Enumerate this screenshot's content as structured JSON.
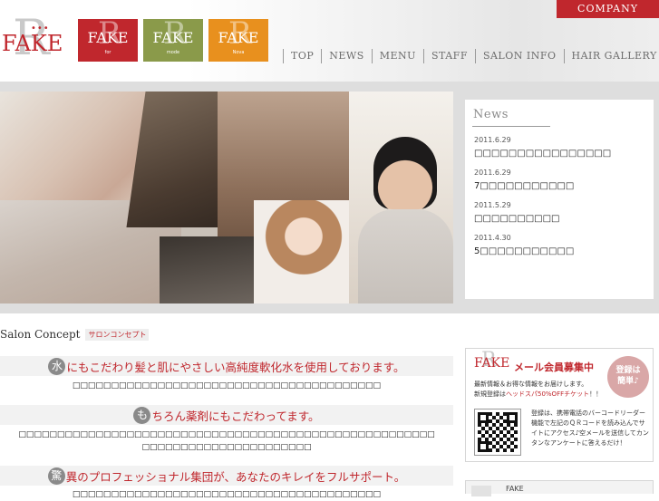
{
  "header": {
    "company_tab": "COMPANY",
    "logo": {
      "letter": "R",
      "name": "FAKE"
    },
    "brands": [
      {
        "letter": "R",
        "name": "FAKE",
        "sub": "for",
        "color": "#c0272d"
      },
      {
        "letter": "R",
        "name": "FAKE",
        "sub": "mode",
        "color": "#8a9a4a"
      },
      {
        "letter": "R",
        "name": "FAKE",
        "sub": "Nova",
        "color": "#e8901e"
      }
    ],
    "nav": [
      "TOP",
      "NEWS",
      "MENU",
      "STAFF",
      "SALON INFO",
      "HAIR GALLERY"
    ]
  },
  "news": {
    "title": "News",
    "items": [
      {
        "date": "2011.6.29",
        "headline": "□□□□□□□□□□□□□□□□"
      },
      {
        "date": "2011.6.29",
        "headline": "7□□□□□□□□□□□"
      },
      {
        "date": "2011.5.29",
        "headline": "□□□□□□□□□□"
      },
      {
        "date": "2011.4.30",
        "headline": "5□□□□□□□□□□□"
      }
    ]
  },
  "concept": {
    "title_en": "Salon Concept",
    "title_jp": "サロンコンセプト",
    "sections": [
      {
        "mark": "水",
        "headline": "にもこだわり髪と肌にやさしい高純度軟化水を使用しております。",
        "body": [
          "□□□□□□□□□□□□□□□□□□□□□□□□□□□□□□□□□□□□□□□□"
        ]
      },
      {
        "mark": "も",
        "headline": "ちろん薬剤にもこだわってます。",
        "body": [
          "□□□□□□□□□□□□□□□□□□□□□□□□□□□□□□□□□□□□□□□□□□□□□□□□□□□□□□",
          "□□□□□□□□□□□□□□□□□□□□□□"
        ]
      },
      {
        "mark": "驚",
        "headline": "異のプロフェッショナル集団が、あなたのキレイをフルサポート。",
        "body": [
          "□□□□□□□□□□□□□□□□□□□□□□□□□□□□□□□□□□□□□□□□"
        ]
      }
    ]
  },
  "member": {
    "logo_letter": "R",
    "logo_name": "FAKE",
    "headline": "メール会員募集中",
    "badge": [
      "登録は",
      "簡単♪"
    ],
    "lead_line1": "最新情報＆お得な情報をお届けします。",
    "lead_line2_prefix": "新規登録は",
    "lead_line2_red": "ヘッドスパ50%OFFチケット",
    "lead_line2_suffix": "！！",
    "description": "登録は、携帯電話のバーコードリーダー機能で左記のＱＲコードを読み込んでサイトにアクセス♪空メールを送信してカンタンなアンケートに答えるだけ！"
  },
  "bottom_card": {
    "title": "FAKE"
  }
}
